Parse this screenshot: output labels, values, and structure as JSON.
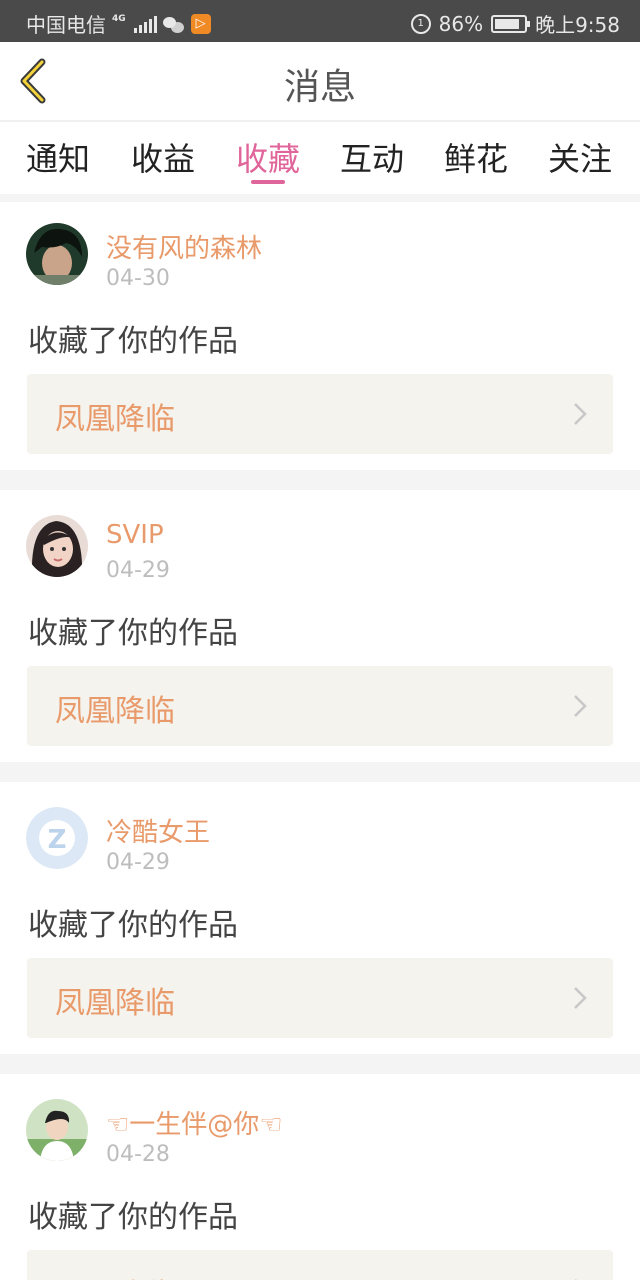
{
  "status_bar": {
    "carrier": "中国电信",
    "network": "4G",
    "battery_percent": "86%",
    "battery_level": 0.86,
    "time": "晚上9:58"
  },
  "header": {
    "title": "消息",
    "back_icon": "chevron-left-icon"
  },
  "tabs": [
    {
      "label": "通知",
      "active": false
    },
    {
      "label": "收益",
      "active": false
    },
    {
      "label": "收藏",
      "active": true
    },
    {
      "label": "互动",
      "active": false
    },
    {
      "label": "鲜花",
      "active": false
    },
    {
      "label": "关注",
      "active": false
    }
  ],
  "colors": {
    "accent": "#e0659a",
    "username": "#e99a6a",
    "date": "#bdbdbd",
    "work_bg": "#f5f3ee"
  },
  "messages": [
    {
      "username": "没有风的森林",
      "date": "04-30",
      "action": "收藏了你的作品",
      "work_title": "凤凰降临"
    },
    {
      "username": "SVIP",
      "date": "04-29",
      "action": "收藏了你的作品",
      "work_title": "凤凰降临"
    },
    {
      "username": "冷酷女王",
      "date": "04-29",
      "action": "收藏了你的作品",
      "work_title": "凤凰降临"
    },
    {
      "username": "☜一生伴@你☜",
      "date": "04-28",
      "action": "收藏了你的作品",
      "work_title": "凤凰降临"
    }
  ]
}
